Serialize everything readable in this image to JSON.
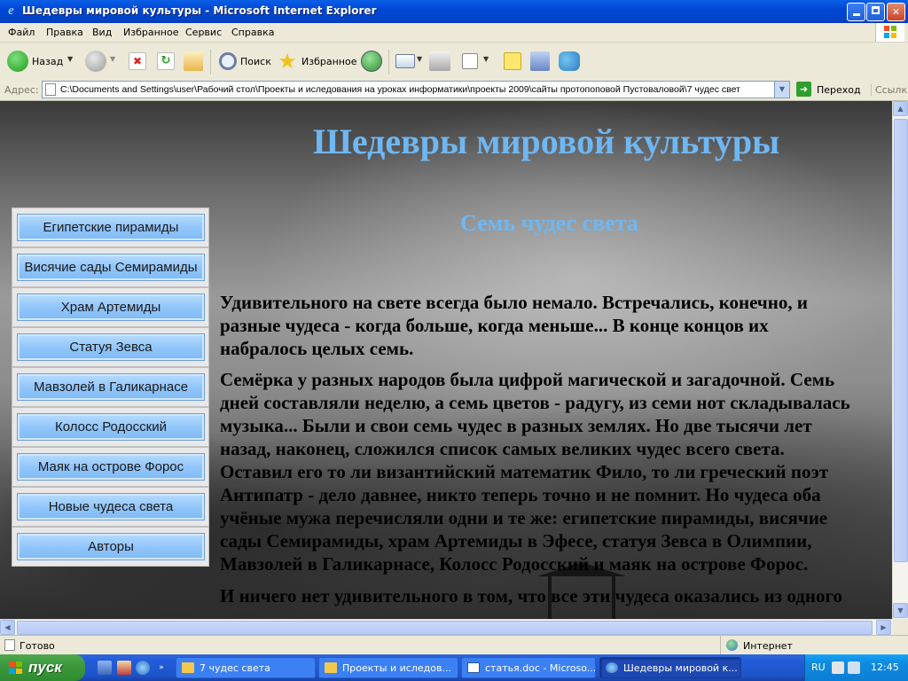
{
  "window": {
    "title": "Шедевры мировой культуры - Microsoft Internet Explorer",
    "app_icon": "ie-icon"
  },
  "menu": [
    "Файл",
    "Правка",
    "Вид",
    "Избранное",
    "Сервис",
    "Справка"
  ],
  "toolbar": {
    "back_label": "Назад",
    "search_label": "Поиск",
    "favorites_label": "Избранное"
  },
  "address": {
    "label": "Адрес:",
    "url": "C:\\Documents and Settings\\user\\Рабочий стол\\Проекты и иследования на уроках информатики\\проекты 2009\\сайты протопоповой Пустоваловой\\7 чудес свет",
    "go_label": "Переход",
    "links_label": "Ссылки"
  },
  "page": {
    "heading": "Шедевры мировой культуры",
    "subheading": "Семь чудес света",
    "nav": [
      "Египетские пирамиды",
      "Висячие сады Семирамиды",
      "Храм Артемиды",
      "Статуя Зевса",
      "Мавзолей в Галикарнасе",
      "Колосс Родосский",
      "Маяк на острове Форос",
      "Новые чудеса света",
      "Авторы"
    ],
    "paragraph1": [
      "Удивительного на свете всегда было немало. Встречались, конечно,  и",
      "разные чудеса - когда больше, когда меньше... В конце концов их",
      "набралось целых семь."
    ],
    "paragraph2": [
      "Семёрка у разных народов была цифрой магической и загадочной. Семь",
      "дней составляли неделю, а семь цветов - радугу, из семи нот складывалась",
      "музыка... Были и свои семь чудес в разных землях. Но две тысячи лет",
      "назад, наконец, сложился список самых великих чудес всего света.",
      "Оставил его то ли византийский математик Фило, то ли  греческий поэт",
      "Антипатр - дело давнее, никто теперь точно и не помнит. Но чудеса оба",
      "учёные мужа перечисляли одни и те же: египетские пирамиды, висячие",
      "сады Семирамиды, храм Артемиды в Эфесе, статуя Зевса в Олимпии,",
      "Мавзолей в Галикарнасе, Колосс Родосский и маяк на острове Форос."
    ],
    "paragraph3": [
      "И ничего нет удивительного в том, что все эти чудеса оказались из одного"
    ]
  },
  "status": {
    "text": "Готово",
    "zone": "Интернет"
  },
  "taskbar": {
    "start_label": "пуск",
    "tasks": [
      "7 чудес света",
      "Проекты и иследов...",
      "статья.doc - Microso...",
      "Шедевры мировой к..."
    ],
    "active_task": 3,
    "lang": "RU",
    "clock": "12:45"
  },
  "colors": {
    "heading": "#6FB7F3",
    "nav_button": "#92C6FA",
    "title_bar": "#0046D5",
    "taskbar": "#245DDB",
    "start_button": "#3C9A3C"
  }
}
